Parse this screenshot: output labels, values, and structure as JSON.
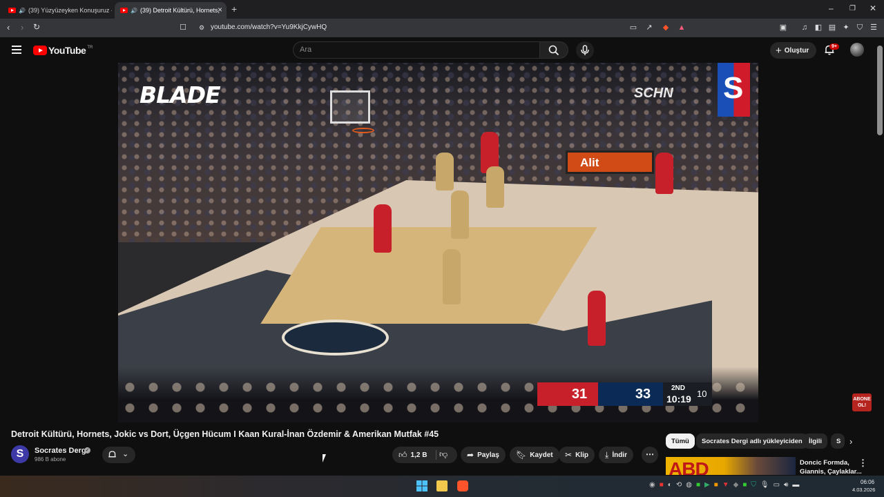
{
  "browser": {
    "tabs": [
      {
        "label": "(39) Yüzyüzeyken Konuşuruz - Az"
      },
      {
        "label": "(39) Detroit Kültürü, Hornets,"
      }
    ],
    "url": "youtube.com/watch?v=Yu9KkjCywHQ"
  },
  "youtube": {
    "logo_text": "YouTube",
    "region": "TR",
    "search_placeholder": "Ara",
    "create_label": "Oluştur",
    "notifications_badge": "9+"
  },
  "video": {
    "overlay_brand": "BLADE",
    "overlay_right": "SCHN",
    "ad_board": "Alit",
    "scoreboard": {
      "home_score": "31",
      "away_score": "33",
      "period": "2ND",
      "clock": "10:19",
      "shot_clock": "10"
    },
    "subscribe_sticker": "ABONE OL!"
  },
  "meta": {
    "title": "Detroit Kültürü, Hornets, Jokic vs Dort, Üçgen Hücum I Kaan Kural-İnan Özdemir & Amerikan Mutfak #45",
    "channel_initial": "S",
    "channel_name": "Socrates Dergi",
    "subscribers": "986 B abone",
    "likes": "1,2 B",
    "share_label": "Paylaş",
    "save_label": "Kaydet",
    "clip_label": "Klip",
    "download_label": "İndir"
  },
  "sidebar": {
    "chips": [
      "Tümü",
      "Socrates Dergi adlı yükleyiciden",
      "İlgili",
      "S"
    ],
    "recommendation": {
      "thumb_text": "ABD",
      "title": "Doncic Formda, Giannis, Çaylaklar..."
    }
  },
  "taskbar": {
    "time": "06:06",
    "date": "4.03.2026"
  }
}
